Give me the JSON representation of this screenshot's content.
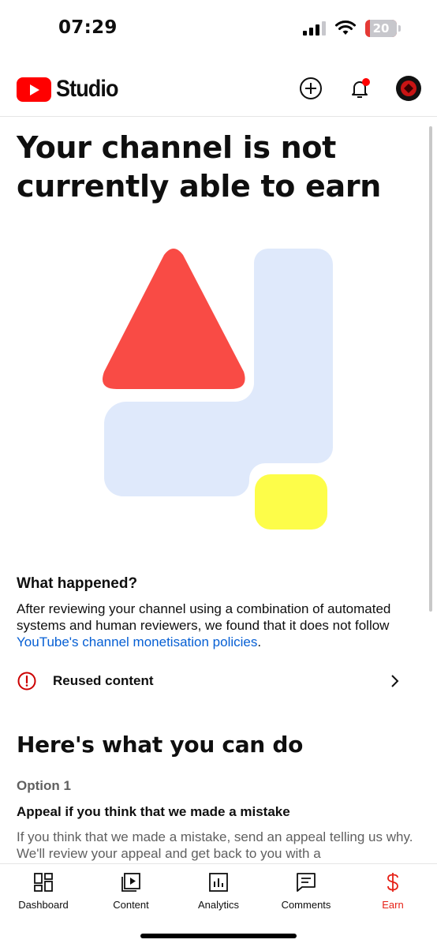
{
  "status_bar": {
    "time": "07:29",
    "battery": "20"
  },
  "header": {
    "app_name": "Studio"
  },
  "page": {
    "title": "Your channel is not currently able to earn",
    "what_happened": {
      "heading": "What happened?",
      "body": "After reviewing your channel using a combination of automated systems and human reviewers, we found that it does not follow ",
      "link": "YouTube's channel monetisation policies",
      "end": "."
    },
    "issue": {
      "label": "Reused content"
    },
    "actions": {
      "heading": "Here's what you can do",
      "option_label": "Option 1",
      "option_title": "Appeal if you think that we made a mistake",
      "option_text": "If you think that we made a mistake, send an appeal telling us why. We'll review your appeal and get back to you with a"
    }
  },
  "bottom_nav": [
    {
      "label": "Dashboard",
      "icon": "dashboard-icon"
    },
    {
      "label": "Content",
      "icon": "content-icon"
    },
    {
      "label": "Analytics",
      "icon": "analytics-icon"
    },
    {
      "label": "Comments",
      "icon": "comments-icon"
    },
    {
      "label": "Earn",
      "icon": "earn-icon",
      "active": true
    }
  ],
  "colors": {
    "brand": "#ff0000",
    "link": "#065fd4",
    "active_nav": "#e62117",
    "illustration_red": "#f94b45",
    "illustration_blue": "#dfe9fb",
    "illustration_yellow": "#fdfd49"
  }
}
